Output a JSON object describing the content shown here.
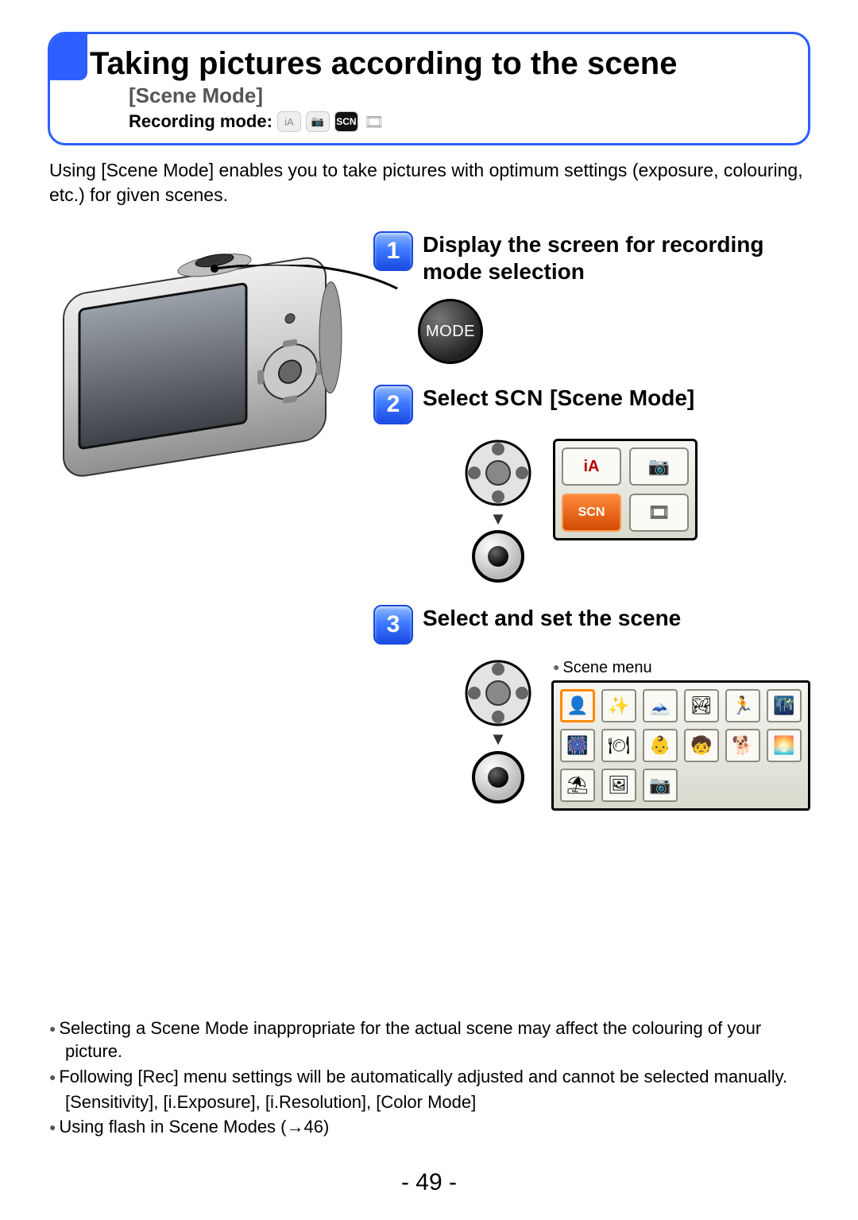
{
  "header": {
    "title": "Taking pictures according to the scene",
    "subtitle": "[Scene Mode]",
    "recording_label": "Recording mode:",
    "mode_ia": "iA",
    "mode_cam": "📷",
    "mode_scn": "SCN",
    "mode_film": "🎞"
  },
  "intro": "Using [Scene Mode] enables you to take pictures with optimum settings (exposure, colouring, etc.) for given scenes.",
  "steps": {
    "s1_num": "1",
    "s1_title": "Display the screen for recording mode selection",
    "mode_button": "MODE",
    "s2_num": "2",
    "s2_pre": "Select ",
    "s2_scn": "SCN",
    "s2_post": " [Scene Mode]",
    "s3_num": "3",
    "s3_title": "Select and set the scene",
    "scene_menu_caption": "Scene menu"
  },
  "mode_panel": {
    "ia": "iA",
    "cam": "📷",
    "scn": "SCN",
    "film": "🎞"
  },
  "scene_icons": {
    "r1c1": "👤",
    "r1c2": "✨",
    "r1c3": "🗻",
    "r1c4": "🏞",
    "r1c5": "🏃",
    "r1c6": "🌃",
    "r2c1": "🎆",
    "r2c2": "🍽",
    "r2c3": "👶",
    "r2c4": "🧒",
    "r2c5": "🐕",
    "r2c6": "🌅",
    "r3c1": "⛱",
    "r3c2": "🖼",
    "r3c3": "📷"
  },
  "notes": {
    "n1": "Selecting a Scene Mode inappropriate for the actual scene may affect the colouring of your picture.",
    "n2": "Following [Rec] menu settings will be automatically adjusted and cannot be selected manually.",
    "n2b": "[Sensitivity], [i.Exposure], [i.Resolution], [Color Mode]",
    "n3": "Using flash in Scene Modes (→46)"
  },
  "page_number": "- 49 -"
}
